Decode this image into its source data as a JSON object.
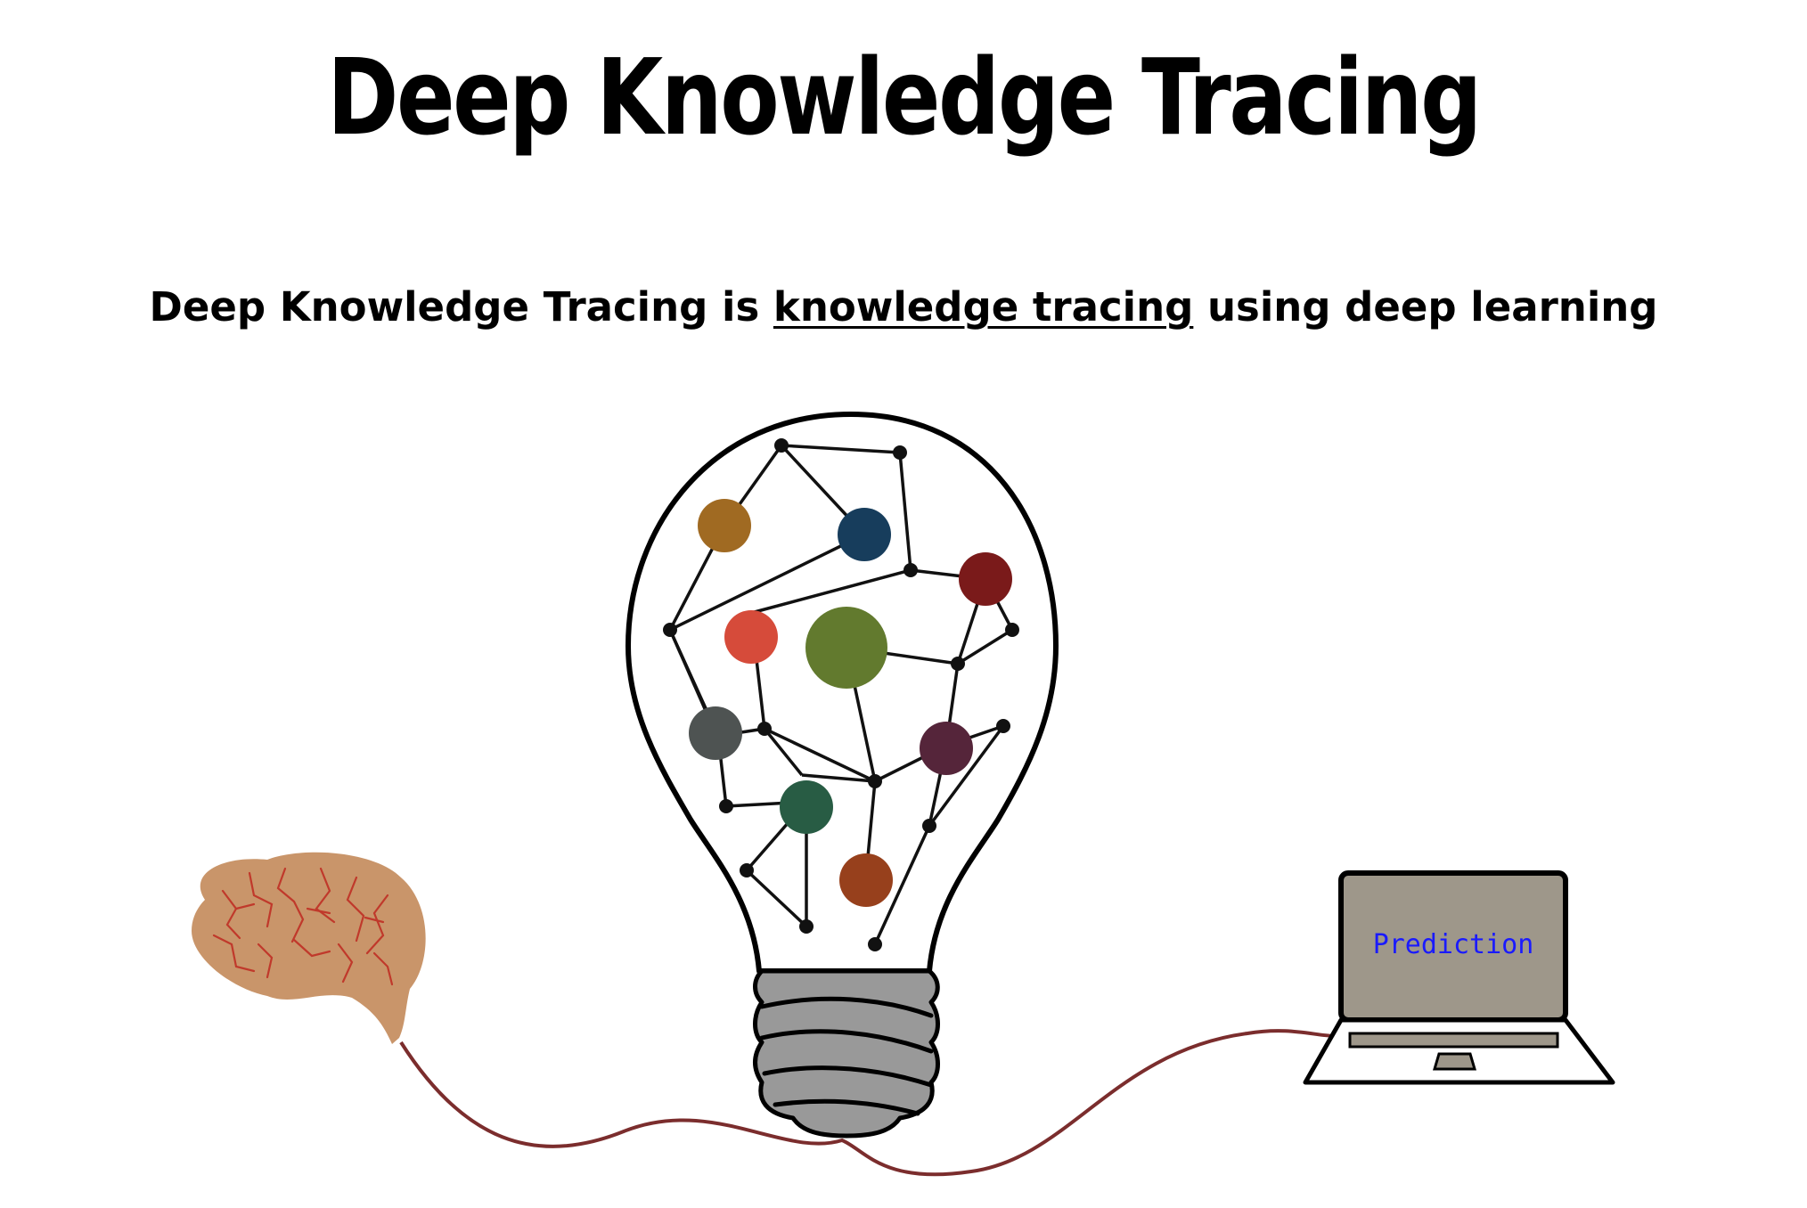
{
  "title": "Deep Knowledge Tracing",
  "subtitle": {
    "prefix": "Deep Knowledge Tracing is ",
    "link": "knowledge tracing",
    "suffix": " using deep learning"
  },
  "laptop": {
    "screen_text": "Prediction",
    "screen_color": "#9e978a"
  },
  "colors": {
    "brain": "#c9956a",
    "brain_veins": "#c0392b",
    "cable": "#7b2d2d",
    "bulb_outline": "#000000",
    "bulb_base": "#999999",
    "prediction_text": "#1a1aff"
  },
  "network_nodes": [
    {
      "color": "#a06a22"
    },
    {
      "color": "#173d5c"
    },
    {
      "color": "#7a1a1a"
    },
    {
      "color": "#d64b3a"
    },
    {
      "color": "#627a2e"
    },
    {
      "color": "#4e5352"
    },
    {
      "color": "#55253a"
    },
    {
      "color": "#285c44"
    },
    {
      "color": "#97401c"
    }
  ],
  "icons": [
    "lightbulb-icon",
    "brain-icon",
    "laptop-icon",
    "neural-network-icon"
  ]
}
